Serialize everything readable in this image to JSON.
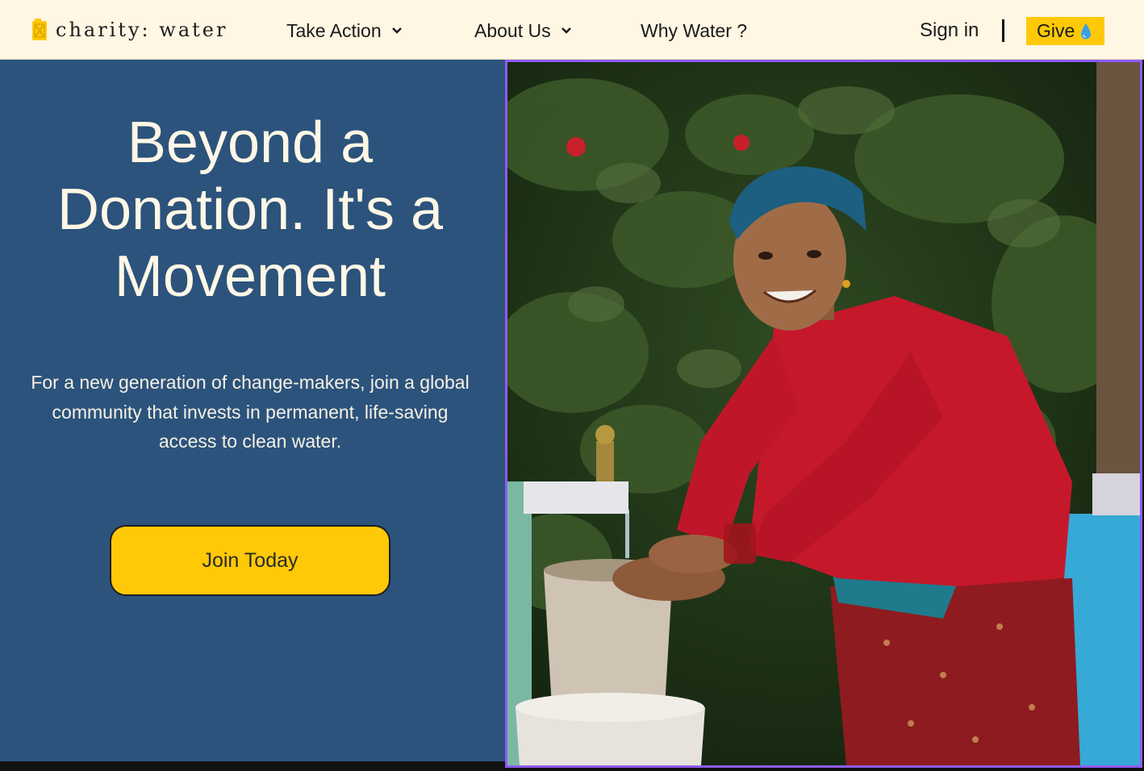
{
  "nav": {
    "logo_text": "charity: water",
    "logo_icon": "jerrycan-icon",
    "items": [
      {
        "label": "Take Action",
        "has_dropdown": true
      },
      {
        "label": "About Us",
        "has_dropdown": true
      },
      {
        "label": "Why Water ?",
        "has_dropdown": false
      }
    ],
    "sign_in": "Sign in",
    "give": "Give",
    "give_icon": "water-drop-icon"
  },
  "hero": {
    "headline": "Beyond a Donation. It's a Movement",
    "subtext": "For a new generation of change-makers, join a global community that invests in permanent, life-saving access to clean water.",
    "cta": "Join Today",
    "image_alt": "Woman smiling while washing her hands under a water tap"
  },
  "colors": {
    "nav_bg": "#fff6e3",
    "hero_bg": "#2c537c",
    "accent_yellow": "#ffc907",
    "headline_text": "#fff7e6",
    "image_outline": "#8f5bf5"
  }
}
